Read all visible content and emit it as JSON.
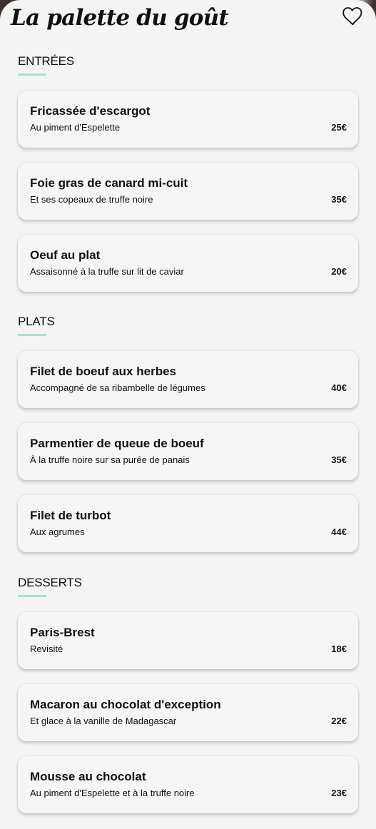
{
  "restaurant": {
    "title": "La palette du goût"
  },
  "header": {
    "favorite_icon": "heart-outline-icon"
  },
  "menu": {
    "sections": [
      {
        "title": "ENTRÉES",
        "items": [
          {
            "name": "Fricassée d'escargot",
            "description": "Au piment d'Espelette",
            "price": "25€"
          },
          {
            "name": "Foie gras de canard mi-cuit",
            "description": "Et ses copeaux de truffe noire",
            "price": "35€"
          },
          {
            "name": "Oeuf au plat",
            "description": "Assaisonné à la truffe sur lit de caviar",
            "price": "20€"
          }
        ]
      },
      {
        "title": "PLATS",
        "items": [
          {
            "name": "Filet de boeuf aux herbes",
            "description": "Accompagné de sa ribambelle de légumes",
            "price": "40€"
          },
          {
            "name": "Parmentier de queue de boeuf",
            "description": "À la truffe noire sur sa purée de panais",
            "price": "35€"
          },
          {
            "name": "Filet de turbot",
            "description": "Aux agrumes",
            "price": "44€"
          }
        ]
      },
      {
        "title": "DESSERTS",
        "items": [
          {
            "name": "Paris-Brest",
            "description": "Revisité",
            "price": "18€"
          },
          {
            "name": "Macaron au chocolat d'exception",
            "description": "Et glace à la vanille de Madagascar",
            "price": "22€"
          },
          {
            "name": "Mousse au chocolat",
            "description": "Au piment d'Espelette et à la truffe noire",
            "price": "23€"
          }
        ]
      }
    ]
  },
  "colors": {
    "background": "#f4f4f4",
    "accent": "#a6e2cf",
    "text": "#111111"
  }
}
